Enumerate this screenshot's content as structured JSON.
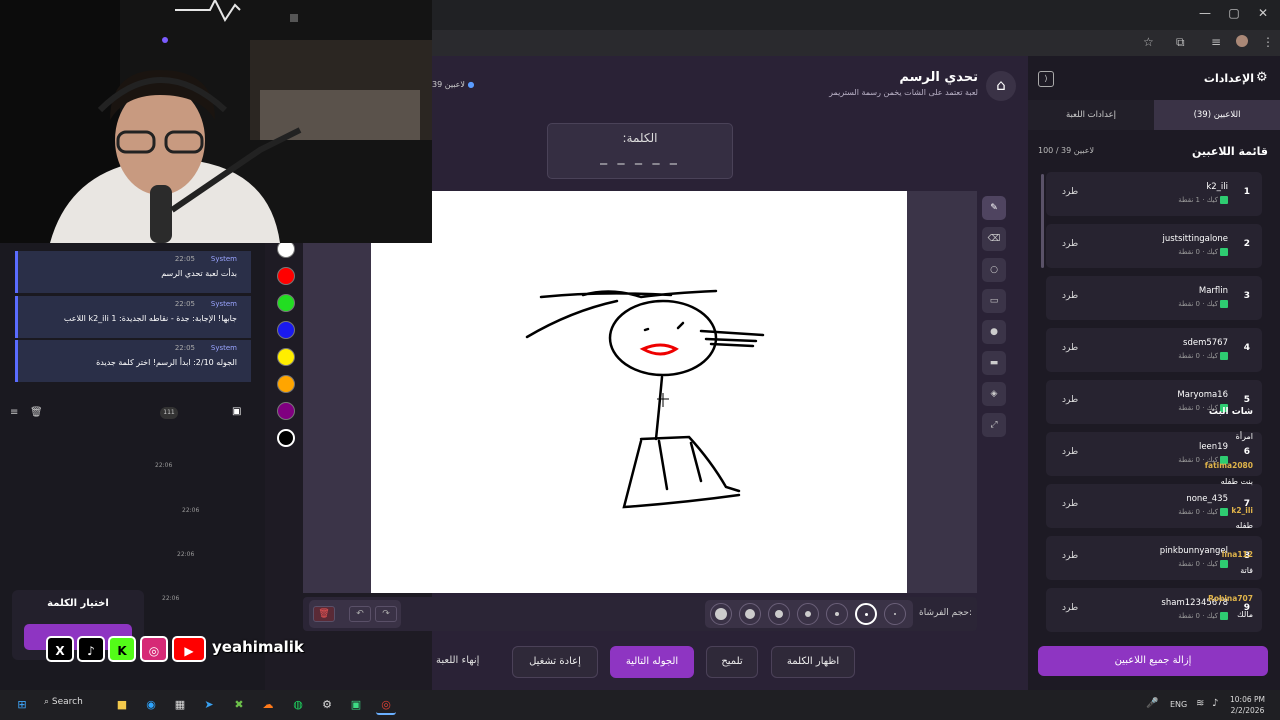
{
  "browser": {
    "online_count": "39 لاعبين"
  },
  "header": {
    "title": "تحدي الرسم",
    "subtitle": "لعبة تعتمد على الشات يخمن رسمة الستريمر"
  },
  "word": {
    "label": "الكلمة:",
    "mask": "_ _ _ _ _"
  },
  "palette": [
    "#ffffff",
    "#ff0000",
    "#22dd22",
    "#1a1aee",
    "#ffee00",
    "#ffa500",
    "#800080",
    "#000000"
  ],
  "toolbar": {
    "brush_size_label": "حجم الفرشاة:"
  },
  "actions": {
    "show_word": "اظهار الكلمة",
    "hint": "تلميح",
    "next_round": "الجوله التالية",
    "restart": "إعادة تشغيل",
    "end_game": "إنهاء اللعبة"
  },
  "settings": {
    "title": "الإعدادات",
    "tab_players": "اللاعبين (39)",
    "tab_game": "إعدادات اللعبة",
    "list_title": "قائمة اللاعبين",
    "count": "100 / 39 لاعبين",
    "remove_all": "إزالة جميع اللاعبين",
    "kick_label": "طرد"
  },
  "players": [
    {
      "idx": "1",
      "name": "k2_ili",
      "stat": "كيك · 1 نقطة"
    },
    {
      "idx": "2",
      "name": "justsittingalone",
      "stat": "كيك · 0 نقطة"
    },
    {
      "idx": "3",
      "name": "Marflin",
      "stat": "كيك · 0 نقطة"
    },
    {
      "idx": "4",
      "name": "sdem5767",
      "stat": "كيك · 0 نقطة"
    },
    {
      "idx": "5",
      "name": "Maryoma16",
      "stat": "كيك · 0 نقطة"
    },
    {
      "idx": "6",
      "name": "leen19",
      "stat": "كيك · 0 نقطة"
    },
    {
      "idx": "7",
      "name": "none_435",
      "stat": "كيك · 0 نقطة"
    },
    {
      "idx": "8",
      "name": "pinkbunnyangel",
      "stat": "كيك · 0 نقطة"
    },
    {
      "idx": "9",
      "name": "sham12345678",
      "stat": "كيك · 0 نقطة"
    }
  ],
  "system_msgs": [
    {
      "sender": "System",
      "time": "22:05",
      "text": "بدأت لعبة تحدي الرسم"
    },
    {
      "sender": "System",
      "time": "22:05",
      "text": "اللاعب k2_ili جابها! الإجابة: جدة - نقاطه الجديدة: 1"
    },
    {
      "sender": "System",
      "time": "22:05",
      "text": "الجوله 2/10: ابدأ الرسم! اختر كلمة جديدة"
    }
  ],
  "chat": {
    "title": "شات البث",
    "count": "111",
    "messages": [
      {
        "user": "",
        "time": "",
        "text": "امرأة"
      },
      {
        "user": "fatima2080",
        "time": "22:06",
        "text": "بنت طفله"
      },
      {
        "user": "k2_ili",
        "time": "22:06",
        "text": "طفله"
      },
      {
        "user": "lina112",
        "time": "22:06",
        "text": "فاتة"
      },
      {
        "user": "Robina707",
        "time": "22:06",
        "text": "مالك"
      }
    ]
  },
  "pick_word": {
    "title": "اختيار الكلمة"
  },
  "social": {
    "handle": "yeahimalik"
  },
  "taskbar": {
    "search": "Search",
    "lang": "ENG",
    "time": "10:06 PM",
    "date": "2/2/2026"
  }
}
